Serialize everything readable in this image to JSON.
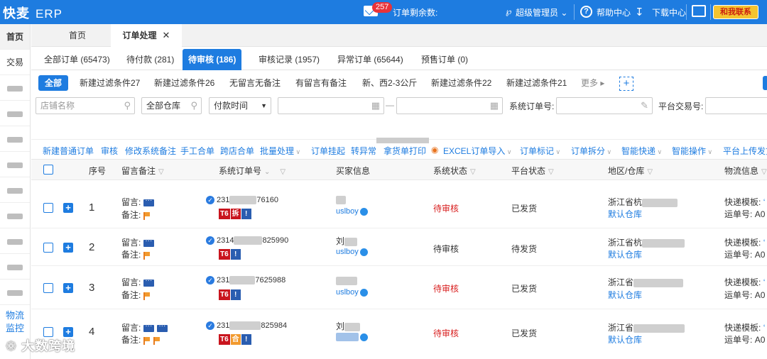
{
  "topbar": {
    "logo": "快麦",
    "app": "ERP",
    "mail_badge": "257",
    "order_remaining_label": "订单剩余数:",
    "user": "超级管理员",
    "help": "帮助中心",
    "download": "下载中心",
    "contact": "和我联系"
  },
  "sidebar": {
    "home": "首页",
    "trade": "交易",
    "logistics_line1": "物流",
    "logistics_line2": "监控"
  },
  "page_tabs": {
    "home": "首页",
    "order_processing": "订单处理",
    "close": "✕"
  },
  "sub_tabs": [
    {
      "label": "全部订单 (65473)"
    },
    {
      "label": "待付款 (281)"
    },
    {
      "label": "待审核 (186)"
    },
    {
      "label": "审核记录 (1957)"
    },
    {
      "label": "异常订单 (65644)"
    },
    {
      "label": "预售订单 (0)"
    }
  ],
  "filters": {
    "all": "全部",
    "items": [
      "新建过滤条件27",
      "新建过滤条件26",
      "无留言无备注",
      "有留言有备注",
      "新、西2-3公斤",
      "新建过滤条件22",
      "新建过滤条件21"
    ],
    "more": "更多 ▸",
    "add": "+"
  },
  "search": {
    "shop_placeholder": "店铺名称",
    "warehouse": "全部仓库",
    "pay_time": "付款时间",
    "dash": "—",
    "sys_order_label": "系统订单号:",
    "platform_trade_label": "平台交易号:"
  },
  "toolbar": {
    "new_order": "新建普通订单",
    "audit": "审核",
    "edit_remark": "修改系统备注",
    "manual_merge": "手工合单",
    "cross_merge": "跨店合单",
    "batch": "批量处理",
    "suspend": "订单挂起",
    "to_abnormal": "转异常",
    "print_pick": "拿货单打印",
    "excel_import": "EXCEL订单导入",
    "order_mark": "订单标记",
    "order_split": "订单拆分",
    "smart_express": "智能快递",
    "smart_ops": "智能操作",
    "platform_upload": "平台上传发货"
  },
  "table": {
    "headers": {
      "seq": "序号",
      "message": "留言备注",
      "sys_order": "系统订单号",
      "buyer": "买家信息",
      "sys_status": "系统状态",
      "platform_status": "平台状态",
      "region": "地区/仓库",
      "logistics": "物流信息"
    },
    "labels": {
      "message": "留言:",
      "remark": "备注:",
      "express_tpl": "快递模板:",
      "waybill": "运单号:",
      "default_wh": "默认仓库"
    },
    "rows": [
      {
        "seq": "1",
        "order_prefix": "231",
        "order_suffix": "76160",
        "buyer_name": "",
        "buyer_id": "uslboy",
        "sys_status": "待审核",
        "platform_status": "已发货",
        "region": "浙江省杭",
        "tpl_val": "‘",
        "waybill_val": "A0"
      },
      {
        "seq": "2",
        "order_prefix": "2314",
        "order_suffix": "825990",
        "buyer_name": "刘",
        "buyer_id": "uslboy",
        "sys_status": "待审核",
        "platform_status": "待发货",
        "region": "浙江省杭",
        "tpl_val": "‘",
        "waybill_val": "A0"
      },
      {
        "seq": "3",
        "order_prefix": "231",
        "order_suffix": "7625988",
        "buyer_name": "",
        "buyer_id": "uslboy",
        "sys_status": "待审核",
        "platform_status": "已发货",
        "region": "浙江省",
        "tpl_val": "‘",
        "waybill_val": "A0"
      },
      {
        "seq": "4",
        "order_prefix": "231",
        "order_suffix": "825984",
        "buyer_name": "刘",
        "buyer_id": "",
        "sys_status": "待审核",
        "platform_status": "已发货",
        "region": "浙江省",
        "tpl_val": "‘",
        "waybill_val": "A0"
      }
    ]
  },
  "watermark": "大数跨境",
  "colors": {
    "brand": "#1e7ce0",
    "alert": "#d81e1e"
  }
}
